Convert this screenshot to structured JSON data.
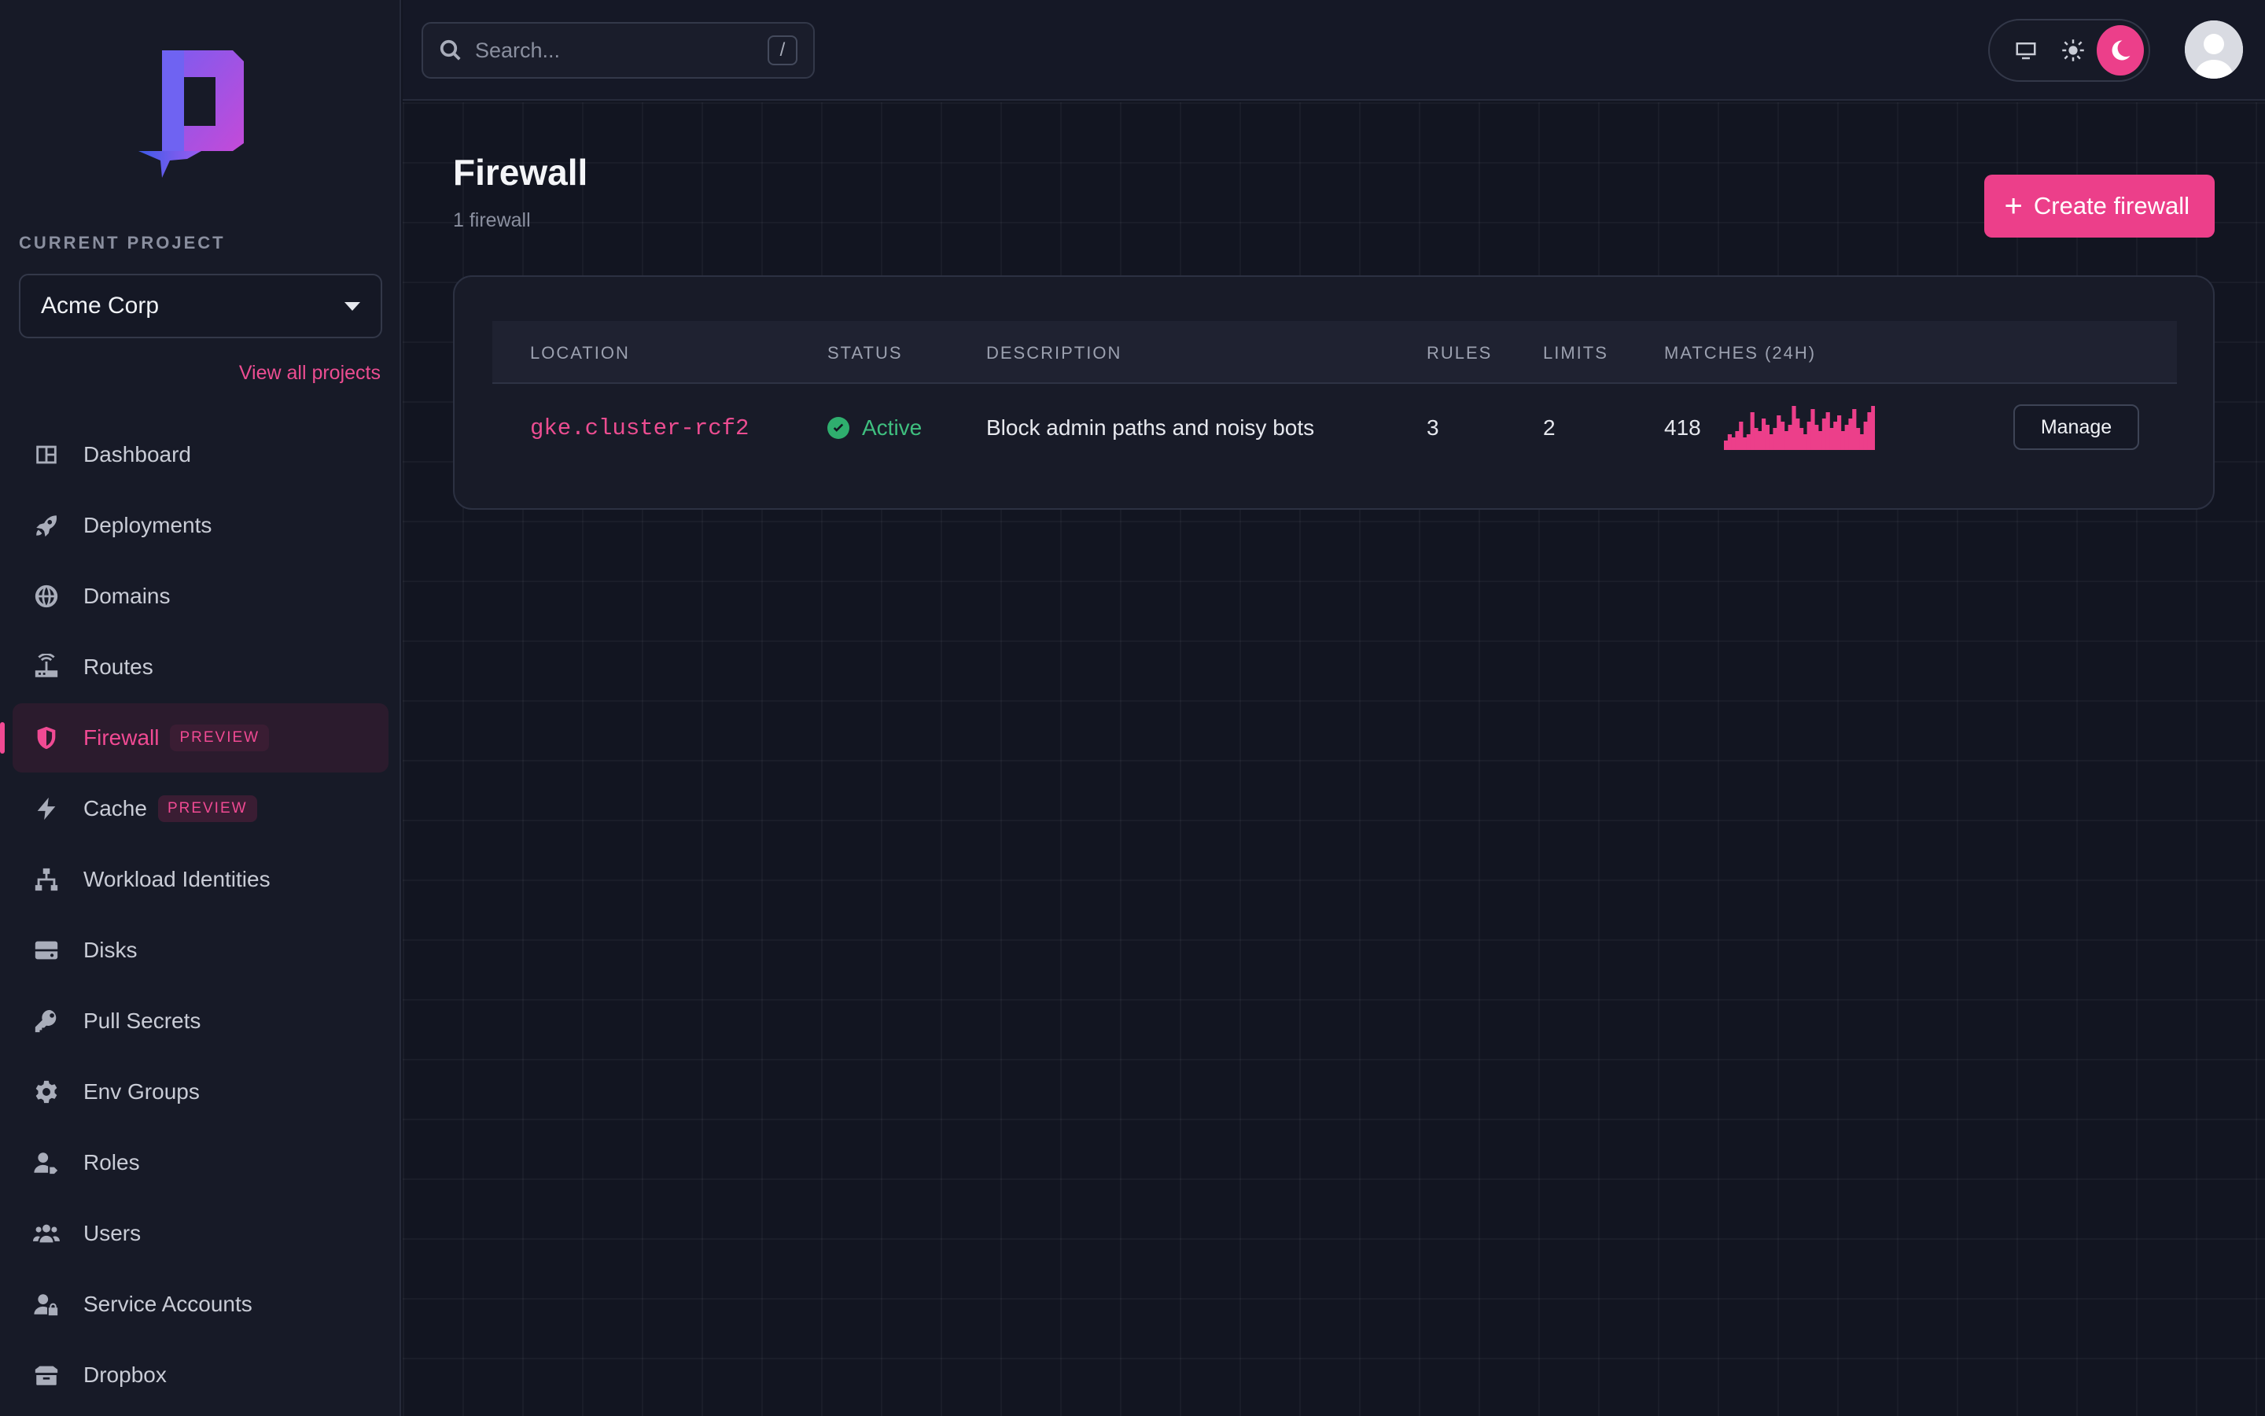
{
  "sidebar": {
    "project_label": "CURRENT PROJECT",
    "project_name": "Acme Corp",
    "view_all": "View all projects",
    "items": [
      {
        "label": "Dashboard",
        "icon": "dashboard-icon"
      },
      {
        "label": "Deployments",
        "icon": "rocket-icon"
      },
      {
        "label": "Domains",
        "icon": "globe-icon"
      },
      {
        "label": "Routes",
        "icon": "router-icon"
      },
      {
        "label": "Firewall",
        "icon": "shield-icon",
        "badge": "PREVIEW",
        "active": true
      },
      {
        "label": "Cache",
        "icon": "bolt-icon",
        "badge": "PREVIEW"
      },
      {
        "label": "Workload Identities",
        "icon": "network-icon"
      },
      {
        "label": "Disks",
        "icon": "disk-icon"
      },
      {
        "label": "Pull Secrets",
        "icon": "key-icon"
      },
      {
        "label": "Env Groups",
        "icon": "gear-icon"
      },
      {
        "label": "Roles",
        "icon": "user-tag-icon"
      },
      {
        "label": "Users",
        "icon": "users-icon"
      },
      {
        "label": "Service Accounts",
        "icon": "user-lock-icon"
      },
      {
        "label": "Dropbox",
        "icon": "box-icon"
      }
    ]
  },
  "topbar": {
    "search_placeholder": "Search...",
    "search_shortcut": "/",
    "theme_options": [
      "monitor-icon",
      "sun-icon",
      "moon-icon"
    ],
    "theme_selected": "moon-icon"
  },
  "page": {
    "title": "Firewall",
    "subtitle": "1 firewall",
    "create_label": "Create firewall"
  },
  "table": {
    "columns": [
      "LOCATION",
      "STATUS",
      "DESCRIPTION",
      "RULES",
      "LIMITS",
      "MATCHES (24H)"
    ],
    "rows": [
      {
        "location": "gke.cluster-rcf2",
        "status": "Active",
        "description": "Block admin paths and noisy bots",
        "rules": "3",
        "limits": "2",
        "matches": "418",
        "action": "Manage"
      }
    ]
  },
  "sparkline": [
    3,
    5,
    4,
    6,
    9,
    4,
    5,
    12,
    7,
    6,
    10,
    8,
    5,
    7,
    11,
    9,
    6,
    8,
    14,
    10,
    7,
    5,
    9,
    13,
    8,
    6,
    10,
    12,
    7,
    9,
    11,
    6,
    8,
    10,
    13,
    7,
    5,
    9,
    12,
    14
  ],
  "colors": {
    "accent": "#ec3f8a",
    "success": "#2fae6e",
    "background": "#121521"
  }
}
